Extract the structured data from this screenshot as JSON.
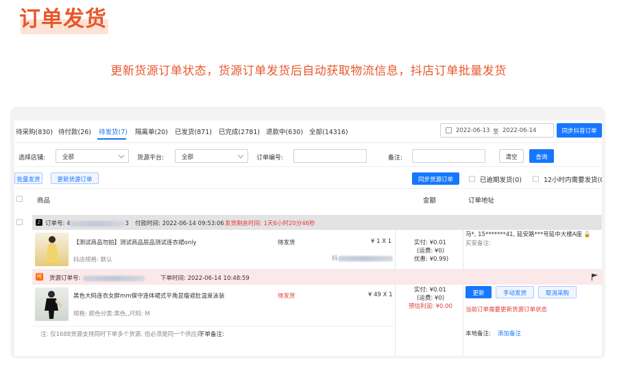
{
  "hero": {
    "title": "订单发货",
    "subtitle": "更新货源订单状态，货源订单发货后自动获取物流信息，抖店订单批量发货"
  },
  "tabs": [
    {
      "label": "待采购(830)"
    },
    {
      "label": "待付款(26)"
    },
    {
      "label": "待发货(7)"
    },
    {
      "label": "隔离单(20)"
    },
    {
      "label": "已发货(871)"
    },
    {
      "label": "已完成(2781)"
    },
    {
      "label": "退款中(630)"
    },
    {
      "label": "全部(14316)"
    }
  ],
  "date_range": {
    "start": "2022-06-14",
    "sep": "至",
    "end": "2022-06-14",
    "start_shown": "2022-06-13"
  },
  "buttons": {
    "sync_douyin": "同步抖音订单",
    "clear": "清空",
    "search": "查询",
    "batch_ship": "批量发货",
    "update_supply": "更新货源订单",
    "sync_supply": "同步货源订单"
  },
  "filters": {
    "shop_label": "选择店铺:",
    "shop_value": "全部",
    "platform_label": "货源平台:",
    "platform_value": "全部",
    "order_no_label": "订单编号:",
    "remark_label": "备注:"
  },
  "checks": {
    "overdue": "已逾期发货(0)",
    "within12": "12小时内需要发货(0"
  },
  "table_headers": {
    "product": "商品",
    "amount": "金额",
    "address": "订单地址"
  },
  "order": {
    "no_label": "订单号: 4",
    "no_tail": "3",
    "pay_time": "付款时间: 2022-06-14 09:53:06",
    "remaining": "发货剩余时间: 1天6小时20分46秒",
    "product_title": "【测试商品勿拍】测试商品层品测试连衣裙only",
    "product_spec": "抖店规格:  默认",
    "status": "待发货",
    "price_qty": "¥ 1 X 1",
    "sku_prefix": "抖",
    "paid": "实付: ¥0.01",
    "shipping": "(运费: ¥0)",
    "discount": "优惠: ¥0.99)",
    "address": "马*,  15*******41,  延安路***号延中大楼A座",
    "buyer_note": "买家备注:"
  },
  "supplier": {
    "no_label": "货源订单号:",
    "order_time": "下单时间: 2022-06-14 10:48:59",
    "product_title": "黑色大码连衣女胖mm保守连体裙式平角显瘦遮肚温泉泳装",
    "product_spec": "规格:  颜色分类:黑色,,尺码:  M",
    "status": "待发货",
    "price_qty": "¥ 49 X 1",
    "paid": "实付: ¥0.01",
    "shipping": "(运费: ¥0)",
    "est_profit": "预估利润: ¥0.00",
    "btn_update": "更新",
    "btn_manual": "手动发货",
    "btn_cancel": "取消采购",
    "warn": "当前订单需要更新货源订单状态",
    "note": "注: 仅1688货源支持同时下单多个货源, 但必须是同一个供应商",
    "order_note_label": "下单备注:",
    "local_note_label": "本地备注:",
    "add_note": "添加备注"
  },
  "colors": {
    "accent": "#e8572a",
    "primary": "#1677ff",
    "danger": "#e23c39"
  }
}
